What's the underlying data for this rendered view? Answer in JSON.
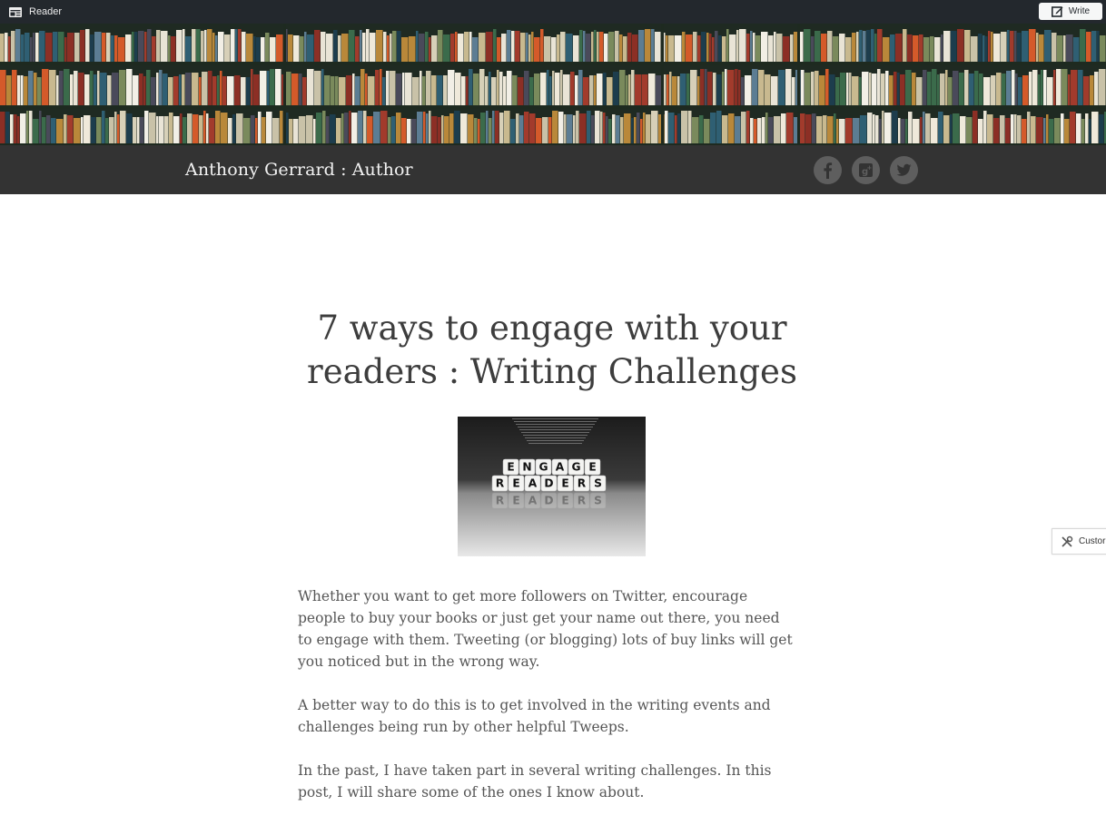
{
  "adminbar": {
    "reader_label": "Reader",
    "write_label": "Write",
    "reader_icon": "reader-icon",
    "write_icon": "pencil-square-icon"
  },
  "header": {
    "image": "bookshelf-header-image",
    "site_title": "Anthony Gerrard : Author",
    "social": [
      "facebook-icon",
      "google-plus-icon",
      "twitter-icon"
    ]
  },
  "post": {
    "title": "7 ways to engage with your readers : Writing Challenges",
    "image": {
      "alt": "engage-readers-letter-dice-image",
      "word1": "ENGAGE",
      "word2": "READERS"
    },
    "paragraphs": [
      "Whether you want to get more followers on Twitter, encourage people to buy your books or just get your name out there, you need to engage with them. Tweeting (or blogging) lots of buy links will get you noticed but in the wrong way.",
      "A better way to do this is to get involved in the writing events and challenges being run by other helpful Tweeps.",
      "In the past, I have taken part in several writing challenges. In this post, I will share some of the ones I know about."
    ]
  },
  "customize": {
    "label": "Custor",
    "icon": "tools-icon"
  },
  "colors": {
    "adminbar_bg": "#23282d",
    "titlebar_bg": "#333333",
    "title_text": "#3d3d3d",
    "body_text": "#555555",
    "social_bg": "#5e5e5e"
  }
}
